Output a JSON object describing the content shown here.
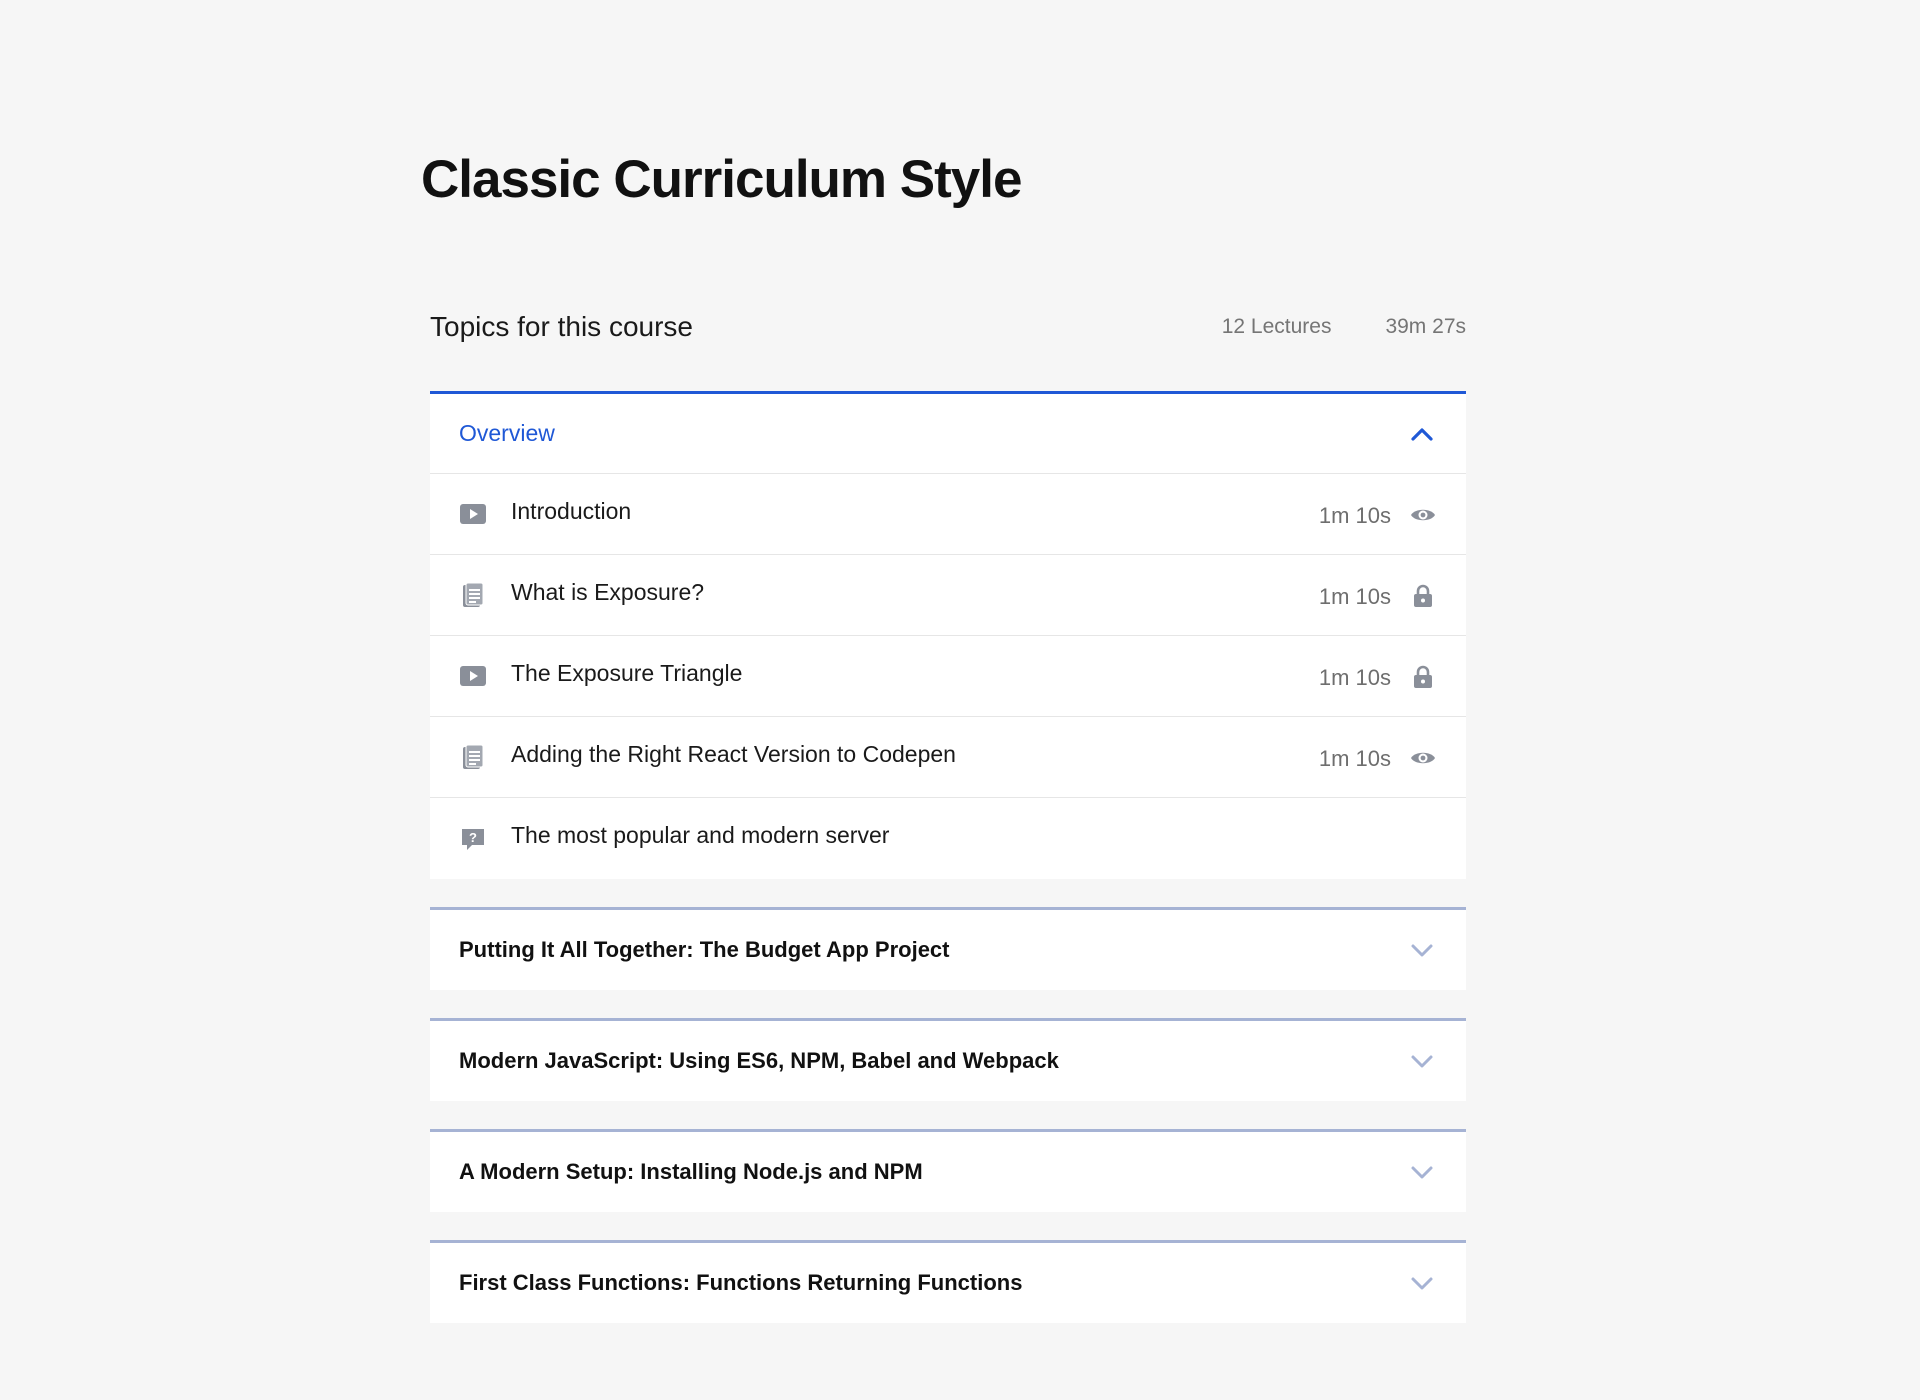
{
  "page": {
    "title": "Classic Curriculum Style"
  },
  "topics": {
    "title": "Topics for this course",
    "lectures_count": "12 Lectures",
    "total_duration": "39m 27s"
  },
  "colors": {
    "accent": "#1f58d6",
    "collapsed_border": "#a6b3d4",
    "icon_gray": "#8a8f99",
    "background": "#f6f6f6"
  },
  "sections": [
    {
      "title": "Overview",
      "expanded": true,
      "lectures": [
        {
          "title": "Introduction",
          "duration": "1m 10s",
          "type_icon": "video-icon",
          "status_icon": "eye-icon"
        },
        {
          "title": "What is Exposure?",
          "duration": "1m 10s",
          "type_icon": "document-icon",
          "status_icon": "lock-icon"
        },
        {
          "title": "The Exposure Triangle",
          "duration": "1m 10s",
          "type_icon": "video-icon",
          "status_icon": "lock-icon"
        },
        {
          "title": "Adding the Right React Version to Codepen",
          "duration": "1m 10s",
          "type_icon": "document-icon",
          "status_icon": "eye-icon"
        },
        {
          "title": "The most popular and modern server",
          "duration": "",
          "type_icon": "quiz-icon",
          "status_icon": ""
        }
      ]
    },
    {
      "title": "Putting It All Together: The Budget App Project",
      "expanded": false
    },
    {
      "title": "Modern JavaScript: Using ES6, NPM, Babel and Webpack",
      "expanded": false
    },
    {
      "title": "A Modern Setup: Installing Node.js and NPM",
      "expanded": false
    },
    {
      "title": "First Class Functions: Functions Returning Functions",
      "expanded": false
    }
  ]
}
